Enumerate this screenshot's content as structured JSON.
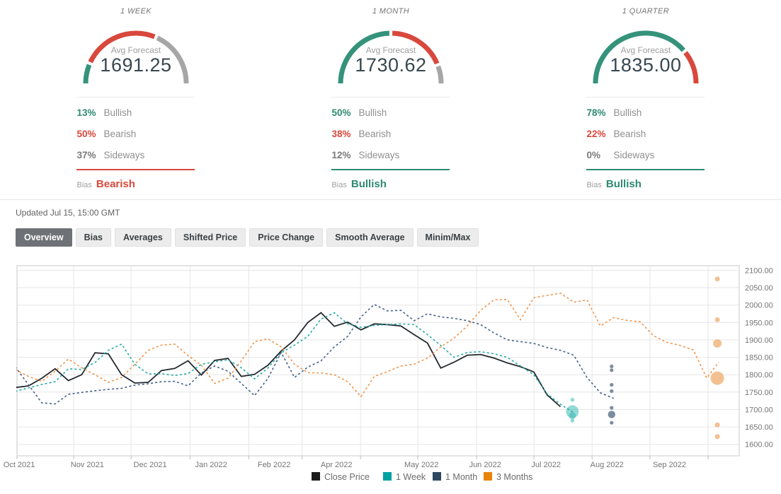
{
  "panels": [
    {
      "period": "1 WEEK",
      "avg_label": "Avg Forecast",
      "avg": "1691.25",
      "segments": {
        "bullish": 13,
        "bearish": 50,
        "sideways": 37
      },
      "rows": [
        {
          "pct": "13%",
          "label": "Bullish"
        },
        {
          "pct": "50%",
          "label": "Bearish"
        },
        {
          "pct": "37%",
          "label": "Sideways"
        }
      ],
      "bias_label": "Bias",
      "bias": "Bearish",
      "bias_key": "bearish"
    },
    {
      "period": "1 MONTH",
      "avg_label": "Avg Forecast",
      "avg": "1730.62",
      "segments": {
        "bullish": 50,
        "bearish": 38,
        "sideways": 12
      },
      "rows": [
        {
          "pct": "50%",
          "label": "Bullish"
        },
        {
          "pct": "38%",
          "label": "Bearish"
        },
        {
          "pct": "12%",
          "label": "Sideways"
        }
      ],
      "bias_label": "Bias",
      "bias": "Bullish",
      "bias_key": "bullish"
    },
    {
      "period": "1 QUARTER",
      "avg_label": "Avg Forecast",
      "avg": "1835.00",
      "segments": {
        "bullish": 78,
        "bearish": 22,
        "sideways": 0
      },
      "rows": [
        {
          "pct": "78%",
          "label": "Bullish"
        },
        {
          "pct": "22%",
          "label": "Bearish"
        },
        {
          "pct": "0%",
          "label": "Sideways"
        }
      ],
      "bias_label": "Bias",
      "bias": "Bullish",
      "bias_key": "bullish"
    }
  ],
  "updated": {
    "text": "Updated Jul 15, 15:00 GMT"
  },
  "tabs": [
    {
      "label": "Overview",
      "active": true
    },
    {
      "label": "Bias",
      "active": false
    },
    {
      "label": "Averages",
      "active": false
    },
    {
      "label": "Shifted Price",
      "active": false
    },
    {
      "label": "Price Change",
      "active": false
    },
    {
      "label": "Smooth Average",
      "active": false
    },
    {
      "label": "Minim/Max",
      "active": false
    }
  ],
  "colors": {
    "gauge_green": "#35927B",
    "gauge_red": "#D8483C",
    "gauge_gray": "#A6A6A6",
    "line_close": "#24292E",
    "line_week": "#25ABA7",
    "line_month": "#466089",
    "line_quarter": "#F0964F",
    "bubble_week": "#2BB3AE",
    "bubble_month": "#64788F",
    "bubble_quarter": "#F2BA85",
    "legend_close": "#1C1C1C",
    "legend_week": "#00A2A2",
    "legend_month": "#2C4760",
    "legend_quarter": "#E8830C",
    "grid": "#E6E6E6",
    "axis_border": "#C9C9C9",
    "tick": "#BBBBBB",
    "axis_text": "#757575",
    "legend_text": "#6B6B6B"
  },
  "chart_data": {
    "type": "line",
    "title": "",
    "xlabel": "",
    "ylabel": "",
    "x_unit": "weeks since Oct 1 2021",
    "ylim": [
      1567,
      2113
    ],
    "yticks": [
      2100,
      2050,
      2000,
      1950,
      1900,
      1850,
      1800,
      1750,
      1700,
      1650,
      1600
    ],
    "grid": true,
    "legend_position": "bottom",
    "month_gridlines_w": [
      4.4,
      8.71,
      13.14,
      17.57,
      21.57,
      25.97,
      30.28,
      34.7,
      39.01,
      43.38,
      47.74,
      52.11
    ],
    "month_labels": [
      {
        "label": "Oct 2021",
        "w": 0.3
      },
      {
        "label": "Nov 2021",
        "w": 5.42
      },
      {
        "label": "Dec 2021",
        "w": 10.15
      },
      {
        "label": "Jan 2022",
        "w": 14.73
      },
      {
        "label": "Feb 2022",
        "w": 19.47
      },
      {
        "label": "Apr 2022",
        "w": 24.16
      },
      {
        "label": "May 2022",
        "w": 30.55
      },
      {
        "label": "Jun 2022",
        "w": 35.34
      },
      {
        "label": "Jul 2022",
        "w": 39.92
      },
      {
        "label": "Aug 2022",
        "w": 44.5
      },
      {
        "label": "Sep 2022",
        "w": 49.2
      }
    ],
    "series": [
      {
        "name": "Close Price",
        "style": "solid",
        "color_key": "line_close",
        "start_week": 0,
        "values": [
          1763,
          1768,
          1790,
          1817,
          1783,
          1800,
          1863,
          1860,
          1800,
          1776,
          1778,
          1812,
          1818,
          1840,
          1799,
          1841,
          1847,
          1795,
          1801,
          1827,
          1868,
          1900,
          1950,
          1978,
          1939,
          1951,
          1929,
          1946,
          1944,
          1940,
          1915,
          1891,
          1819,
          1836,
          1856,
          1858,
          1848,
          1834,
          1823,
          1808,
          1742,
          1708
        ]
      },
      {
        "name": "1 Week",
        "style": "dashed",
        "color_key": "line_week",
        "start_week": 0,
        "values": [
          1752,
          1762,
          1772,
          1780,
          1817,
          1815,
          1835,
          1870,
          1888,
          1830,
          1802,
          1803,
          1798,
          1803,
          1830,
          1837,
          1843,
          1820,
          1788,
          1819,
          1863,
          1885,
          1910,
          1960,
          1978,
          1946,
          1936,
          1942,
          1944,
          1946,
          1944,
          1915,
          1884,
          1850,
          1864,
          1866,
          1860,
          1850,
          1825,
          1800,
          1745,
          1715,
          1691
        ]
      },
      {
        "name": "1 Month",
        "style": "dashed",
        "color_key": "line_month",
        "start_week": 0,
        "values": [
          1823,
          1771,
          1719,
          1716,
          1744,
          1749,
          1754,
          1758,
          1761,
          1770,
          1774,
          1780,
          1781,
          1768,
          1805,
          1825,
          1810,
          1775,
          1740,
          1789,
          1864,
          1792,
          1822,
          1840,
          1880,
          1910,
          1966,
          2002,
          1983,
          1985,
          1955,
          1975,
          1966,
          1962,
          1955,
          1944,
          1920,
          1900,
          1895,
          1890,
          1878,
          1870,
          1856,
          1792,
          1748,
          1732
        ]
      },
      {
        "name": "3 Months",
        "style": "dashed",
        "color_key": "line_quarter",
        "start_week": 0,
        "values": [
          1815,
          1795,
          1781,
          1810,
          1845,
          1820,
          1800,
          1778,
          1792,
          1830,
          1870,
          1885,
          1888,
          1855,
          1827,
          1775,
          1790,
          1840,
          1895,
          1903,
          1880,
          1830,
          1806,
          1805,
          1800,
          1780,
          1737,
          1795,
          1809,
          1825,
          1830,
          1848,
          1880,
          1905,
          1940,
          1985,
          2015,
          2016,
          1958,
          2021,
          2028,
          2034,
          2008,
          2015,
          1940,
          1964,
          1956,
          1952,
          1912,
          1893,
          1884,
          1871,
          1790
        ],
        "tail_point": [
          52.9,
          1836
        ]
      }
    ],
    "forecast_bubbles": [
      {
        "series": "1 Week",
        "w": 41.9,
        "color_key": "bubble_week",
        "opacity": 0.5,
        "items": [
          [
            1728,
            2.8
          ],
          [
            1694,
            9
          ],
          [
            1682,
            5
          ],
          [
            1668,
            2.8
          ]
        ]
      },
      {
        "series": "1 Month",
        "w": 44.85,
        "color_key": "bubble_month",
        "opacity": 0.85,
        "items": [
          [
            1824,
            2.6
          ],
          [
            1813,
            2.6
          ],
          [
            1771,
            2.6
          ],
          [
            1753,
            2.6
          ],
          [
            1705,
            2.6
          ],
          [
            1686,
            5.2
          ],
          [
            1662,
            2.6
          ]
        ]
      },
      {
        "series": "3 Months",
        "w": 52.8,
        "color_key": "bubble_quarter",
        "opacity": 0.9,
        "items": [
          [
            2075,
            3.5
          ],
          [
            1958,
            3.5
          ],
          [
            1890,
            6
          ],
          [
            1790,
            9.5
          ],
          [
            1656,
            3.5
          ],
          [
            1622,
            3.5
          ]
        ]
      }
    ],
    "legend": [
      {
        "label": "Close Price",
        "color_key": "legend_close"
      },
      {
        "label": "1 Week",
        "color_key": "legend_week"
      },
      {
        "label": "1 Month",
        "color_key": "legend_month"
      },
      {
        "label": "3 Months",
        "color_key": "legend_quarter"
      }
    ]
  }
}
